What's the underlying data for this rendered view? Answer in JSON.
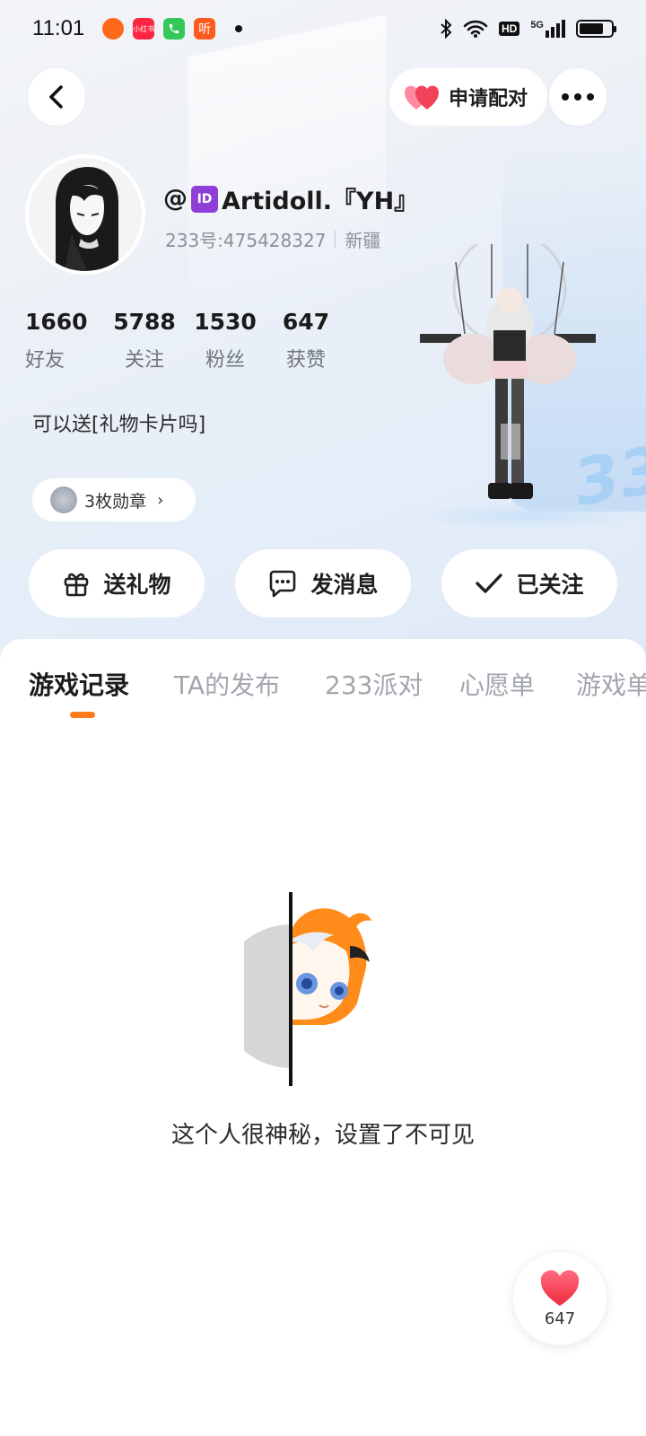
{
  "status_bar": {
    "time": "11:01",
    "app_icons": [
      "taobao-icon",
      "xiaohongshu-icon",
      "phone-icon",
      "ting-icon"
    ],
    "xhs_label": "小红书",
    "ting_label": "听",
    "hd_label": "HD",
    "net_label": "5G",
    "battery_level": 0.75
  },
  "header": {
    "pair_label": "申请配对"
  },
  "profile": {
    "username_prefix": "@",
    "id_badge": "ID",
    "username_main": "Artidoll.『YH』",
    "user_id": "233号:475428327",
    "location": "新疆",
    "bio": "可以送[礼物卡片吗]",
    "medal_label": "3枚勋章"
  },
  "stats": [
    {
      "num": "1660",
      "label": "好友"
    },
    {
      "num": "5788",
      "label": "关注"
    },
    {
      "num": "1530",
      "label": "粉丝"
    },
    {
      "num": "647",
      "label": "获赞"
    }
  ],
  "actions": {
    "gift": "送礼物",
    "message": "发消息",
    "follow": "已关注"
  },
  "tabs": [
    "游戏记录",
    "TA的发布",
    "233派对",
    "心愿单",
    "游戏单"
  ],
  "empty_text": "这个人很神秘，设置了不可见",
  "like_count": "647",
  "colors": {
    "accent": "#ff7a1a",
    "heart": "#f0435a",
    "id_badge": "#8e3fd6"
  }
}
